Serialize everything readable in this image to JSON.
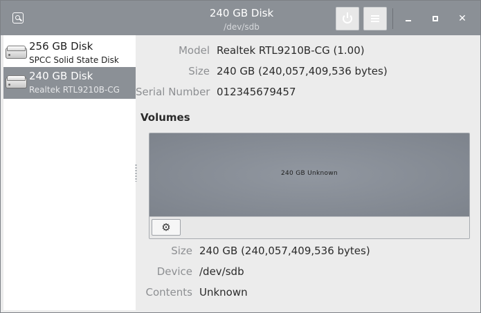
{
  "window": {
    "title": "240 GB Disk",
    "subtitle": "/dev/sdb"
  },
  "titlebar": {
    "icons": {
      "app": "disk-search-icon",
      "power": "power-icon",
      "menu": "hamburger-menu-icon",
      "minimize": "minimize-icon",
      "maximize": "maximize-icon",
      "close": "close-icon"
    },
    "close_glyph": "✕"
  },
  "sidebar": {
    "items": [
      {
        "name": "256 GB Disk",
        "model": "SPCC Solid State Disk",
        "selected": false,
        "icon": "hard-disk-icon"
      },
      {
        "name": "240 GB Disk",
        "model": "Realtek RTL9210B-CG",
        "selected": true,
        "icon": "hard-disk-icon"
      }
    ]
  },
  "details": {
    "model_label": "Model",
    "model_value": "Realtek RTL9210B-CG (1.00)",
    "size_label": "Size",
    "size_value": "240 GB (240,057,409,536 bytes)",
    "serial_label": "Serial Number",
    "serial_value": "012345679457"
  },
  "volumes": {
    "title": "Volumes",
    "partition_label": "240 GB Unknown",
    "gear_glyph": "⚙",
    "size_label": "Size",
    "size_value": "240 GB (240,057,409,536 bytes)",
    "device_label": "Device",
    "device_value": "/dev/sdb",
    "contents_label": "Contents",
    "contents_value": "Unknown"
  },
  "colors": {
    "titlebar": "#8b9096",
    "selection": "#8b9096",
    "volume_bar": "#868c95",
    "background": "#ececec"
  }
}
